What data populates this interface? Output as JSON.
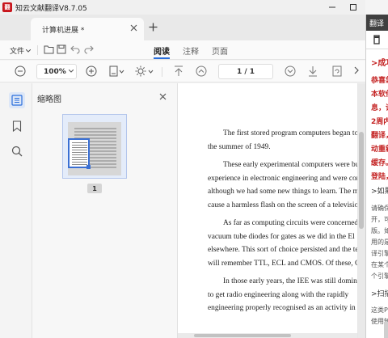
{
  "titlebar": {
    "logo_text": "翻",
    "title": "知云文献翻译V8.7.05"
  },
  "tab": {
    "label": "计算机进展 *"
  },
  "toolbar": {
    "file_label": "文件",
    "modes": [
      "阅读",
      "注释",
      "页面"
    ],
    "active_mode": "阅读"
  },
  "zoom": {
    "value": "100%"
  },
  "pager": {
    "current": "1",
    "total": "1",
    "display": "1 / 1"
  },
  "thumbnail_panel": {
    "title": "缩略图",
    "page_label": "1"
  },
  "document": {
    "paragraphs": [
      [
        "The first stored program computers began to w",
        "the summer of 1949."
      ],
      [
        "These early experimental computers were bu",
        "experience in electronic engineering and were cor",
        "although we had some new things to learn. The mo",
        "cause a harmless flash on the screen of a television s"
      ],
      [
        "As far as computing circuits were concerned,",
        "vacuum tube diodes for gates as we did in the El",
        "elsewhere. This sort of choice persisted and the term",
        "will remember TTL, ECL and CMOS. Of these, CM"
      ],
      [
        "In those early years, the IEE was still dominate",
        "to get radio engineering along with the rapidly",
        "engineering properly recognised as an activity in its"
      ]
    ]
  },
  "right_panel": {
    "header": "翻译",
    "heading1": ">成功",
    "red_lines": [
      "恭喜您",
      "本软件",
      "息，请",
      "2周内",
      "翻译，",
      "动重新",
      "缓存。",
      "登陆，"
    ],
    "heading2": ">如果",
    "gray_lines1": [
      "请确保",
      "开，可",
      "版。如",
      "用的是",
      "译引擎",
      "在某个",
      "个引擎"
    ],
    "heading3": ">扫描",
    "gray_lines2": [
      "这类PD",
      "使用知"
    ]
  },
  "colors": {
    "accent": "#2a6edb",
    "brand_red": "#c8161d",
    "highlight_red": "#c42424"
  }
}
